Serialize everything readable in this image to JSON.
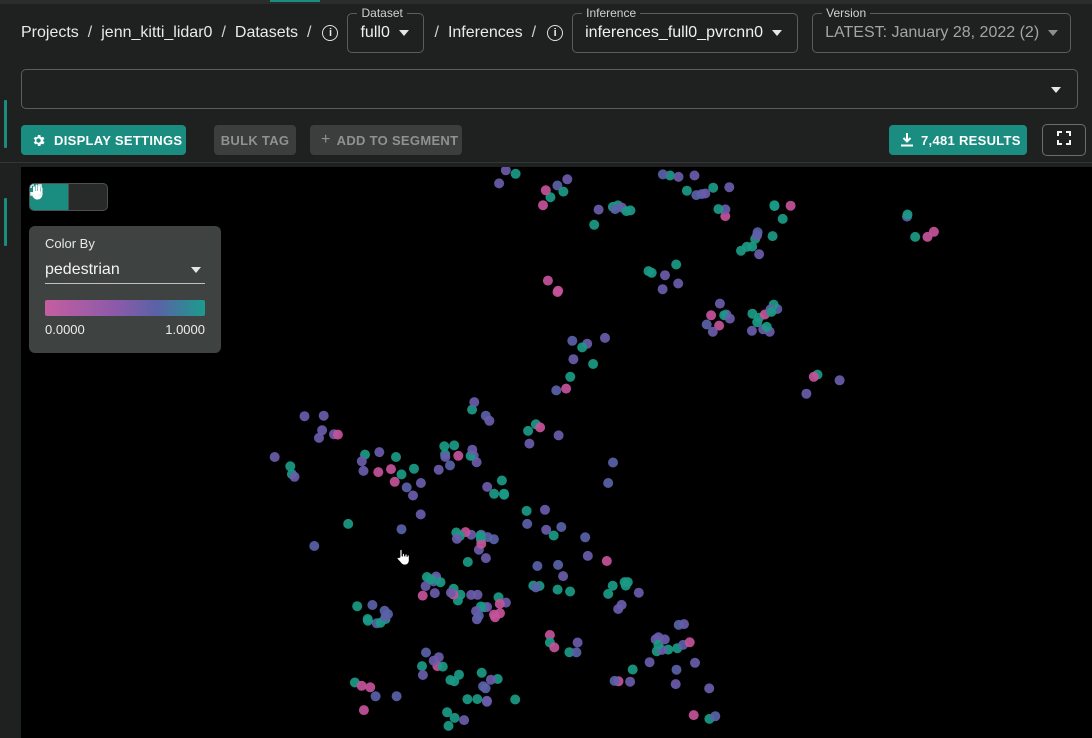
{
  "breadcrumb": [
    "Projects",
    "jenn_kitti_lidar0",
    "Datasets"
  ],
  "crumb_inferences": "Inferences",
  "dataset": {
    "label": "Dataset",
    "value": "full0"
  },
  "inference": {
    "label": "Inference",
    "value": "inferences_full0_pvrcnn0"
  },
  "version": {
    "label": "Version",
    "value": "LATEST: January 28, 2022 (2)"
  },
  "toolbar": {
    "display_settings": "DISPLAY SETTINGS",
    "bulk_tag": "BULK TAG",
    "add_to_segment": "ADD TO SEGMENT",
    "results": "7,481 RESULTS"
  },
  "color_by": {
    "caption": "Color By",
    "value": "pedestrian",
    "min": "0.0000",
    "max": "1.0000",
    "gradient": [
      "#c45ea0",
      "#8b5aa9",
      "#5a62a8",
      "#1b9c8c"
    ]
  },
  "colors": {
    "accent": "#1a8c80",
    "teal_point": "#1a9a86",
    "purple_point": "#6a5cab",
    "pink_point": "#c4539a"
  },
  "icons": [
    "info-icon",
    "caret-down-icon",
    "gear-icon",
    "plus-icon",
    "download-icon",
    "fullscreen-icon",
    "hand-icon",
    "fit-view-icon",
    "pointer-cursor-icon"
  ]
}
